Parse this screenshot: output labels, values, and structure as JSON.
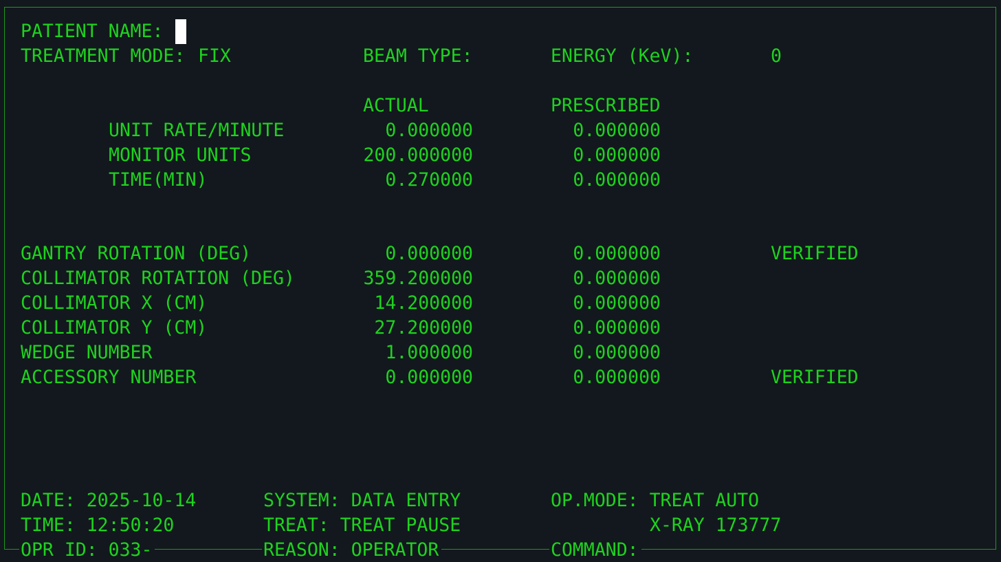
{
  "header": {
    "patient_name_label": "PATIENT NAME:",
    "patient_name_value": "",
    "treatment_mode_label": "TREATMENT MODE:",
    "treatment_mode_value": "FIX",
    "beam_type_label": "BEAM TYPE:",
    "beam_type_value": "",
    "energy_label": "ENERGY (KeV):",
    "energy_value": "0"
  },
  "columns": {
    "actual": "ACTUAL",
    "prescribed": "PRESCRIBED"
  },
  "dose_rows": [
    {
      "label": "UNIT RATE/MINUTE",
      "actual": "0.000000",
      "prescribed": "0.000000"
    },
    {
      "label": "MONITOR UNITS",
      "actual": "200.000000",
      "prescribed": "0.000000"
    },
    {
      "label": "TIME(MIN)",
      "actual": "0.270000",
      "prescribed": "0.000000"
    }
  ],
  "geometry_rows": [
    {
      "label": "GANTRY ROTATION (DEG)",
      "actual": "0.000000",
      "prescribed": "0.000000",
      "status": "VERIFIED"
    },
    {
      "label": "COLLIMATOR ROTATION (DEG)",
      "actual": "359.200000",
      "prescribed": "0.000000",
      "status": ""
    },
    {
      "label": "COLLIMATOR X (CM)",
      "actual": "14.200000",
      "prescribed": "0.000000",
      "status": ""
    },
    {
      "label": "COLLIMATOR Y (CM)",
      "actual": "27.200000",
      "prescribed": "0.000000",
      "status": ""
    },
    {
      "label": "WEDGE NUMBER",
      "actual": "1.000000",
      "prescribed": "0.000000",
      "status": ""
    },
    {
      "label": "ACCESSORY NUMBER",
      "actual": "0.000000",
      "prescribed": "0.000000",
      "status": "VERIFIED"
    }
  ],
  "footer": {
    "date": "DATE: 2025-10-14",
    "time": "TIME: 12:50:20",
    "opr_id": "OPR ID: 033-",
    "system": "SYSTEM: DATA ENTRY",
    "treat": "TREAT: TREAT PAUSE",
    "reason": "REASON: OPERATOR",
    "op_mode": "OP.MODE: TREAT AUTO",
    "xray": "X-RAY 173777",
    "command_label": "COMMAND:",
    "command_value": ""
  },
  "colors": {
    "background": "#12181d",
    "text": "#1fd21f",
    "cursor": "#ffffff"
  }
}
